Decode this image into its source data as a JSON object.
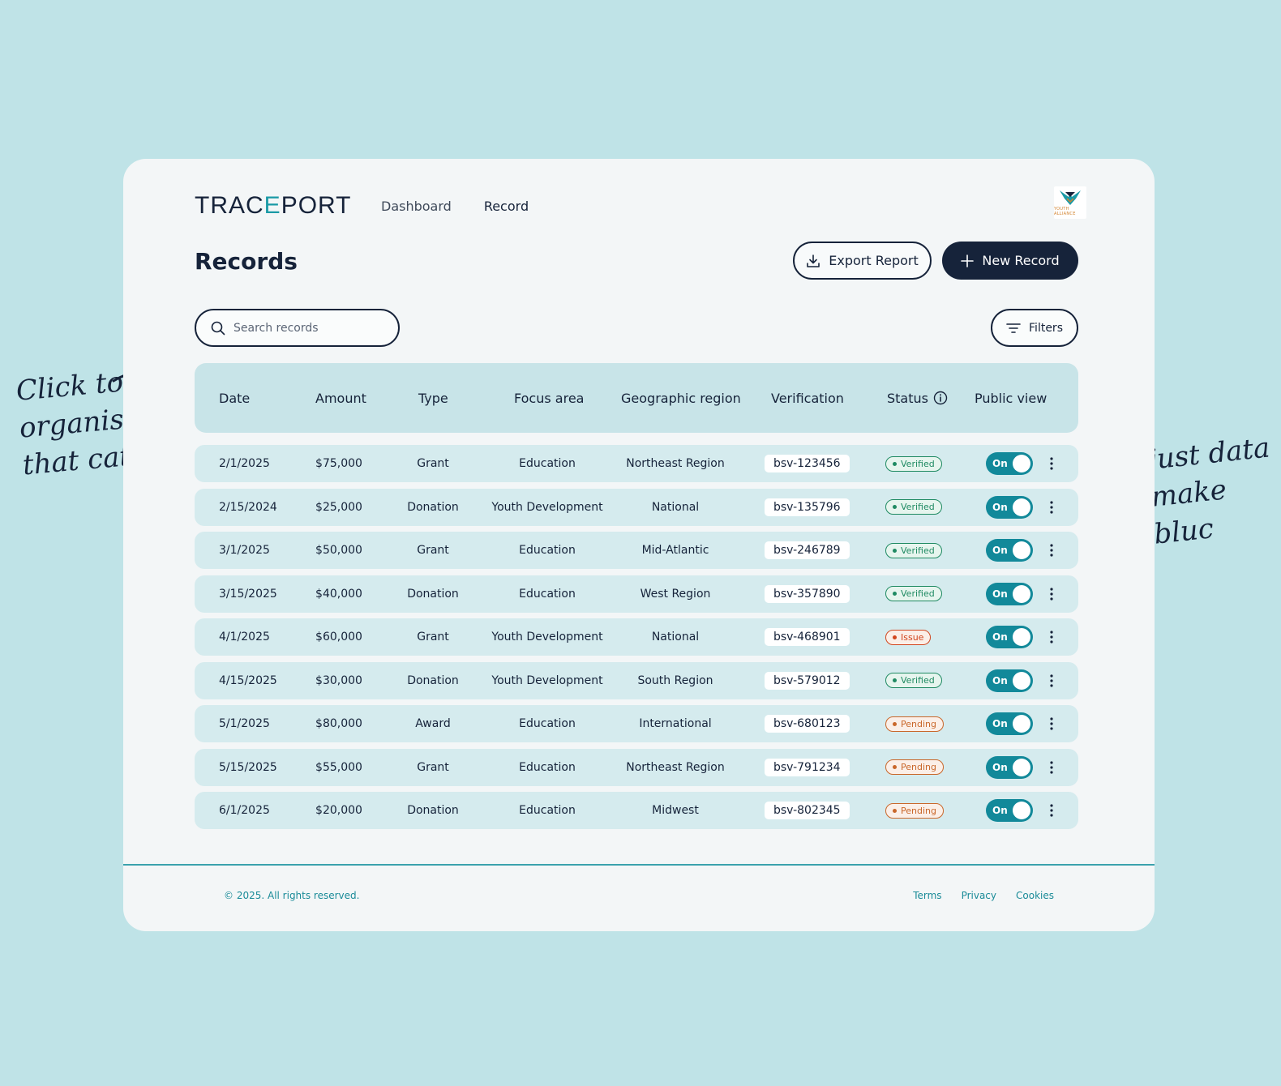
{
  "annotations": {
    "left": "Click to\norganise by\nthat category",
    "right": "Adjust data\nto make\npubluc"
  },
  "header": {
    "logo": {
      "part1": "TRAC",
      "part2": "E",
      "part3": "PORT"
    },
    "nav": [
      "Dashboard",
      "Record"
    ],
    "brand_badge": "YOUTH ALLIANCE"
  },
  "page": {
    "title": "Records",
    "export_label": "Export Report",
    "new_label": "New Record"
  },
  "search": {
    "placeholder": "Search records"
  },
  "filters_label": "Filters",
  "table": {
    "columns": [
      "Date",
      "Amount",
      "Type",
      "Focus area",
      "Geographic region",
      "Verification",
      "Status",
      "Public view"
    ],
    "rows": [
      {
        "date": "2/1/2025",
        "amount": "$75,000",
        "type": "Grant",
        "focus": "Education",
        "region": "Northeast Region",
        "verification": "bsv-123456",
        "status": "Verified",
        "public": "On"
      },
      {
        "date": "2/15/2024",
        "amount": "$25,000",
        "type": "Donation",
        "focus": "Youth Development",
        "region": "National",
        "verification": "bsv-135796",
        "status": "Verified",
        "public": "On"
      },
      {
        "date": "3/1/2025",
        "amount": "$50,000",
        "type": "Grant",
        "focus": "Education",
        "region": "Mid-Atlantic",
        "verification": "bsv-246789",
        "status": "Verified",
        "public": "On"
      },
      {
        "date": "3/15/2025",
        "amount": "$40,000",
        "type": "Donation",
        "focus": "Education",
        "region": "West Region",
        "verification": "bsv-357890",
        "status": "Verified",
        "public": "On"
      },
      {
        "date": "4/1/2025",
        "amount": "$60,000",
        "type": "Grant",
        "focus": "Youth Development",
        "region": "National",
        "verification": "bsv-468901",
        "status": "Issue",
        "public": "On"
      },
      {
        "date": "4/15/2025",
        "amount": "$30,000",
        "type": "Donation",
        "focus": "Youth Development",
        "region": "South Region",
        "verification": "bsv-579012",
        "status": "Verified",
        "public": "On"
      },
      {
        "date": "5/1/2025",
        "amount": "$80,000",
        "type": "Award",
        "focus": "Education",
        "region": "International",
        "verification": "bsv-680123",
        "status": "Pending",
        "public": "On"
      },
      {
        "date": "5/15/2025",
        "amount": "$55,000",
        "type": "Grant",
        "focus": "Education",
        "region": "Northeast Region",
        "verification": "bsv-791234",
        "status": "Pending",
        "public": "On"
      },
      {
        "date": "6/1/2025",
        "amount": "$20,000",
        "type": "Donation",
        "focus": "Education",
        "region": "Midwest",
        "verification": "bsv-802345",
        "status": "Pending",
        "public": "On"
      }
    ]
  },
  "status_colors": {
    "Verified": "#1f8a62",
    "Issue": "#d2461e",
    "Pending": "#c9672a"
  },
  "colors": {
    "background": "#bfe3e7",
    "navy": "#16233a",
    "teal": "#12899a"
  },
  "footer": {
    "copyright": "© 2025. All rights reserved.",
    "links": [
      "Terms",
      "Privacy",
      "Cookies"
    ]
  }
}
